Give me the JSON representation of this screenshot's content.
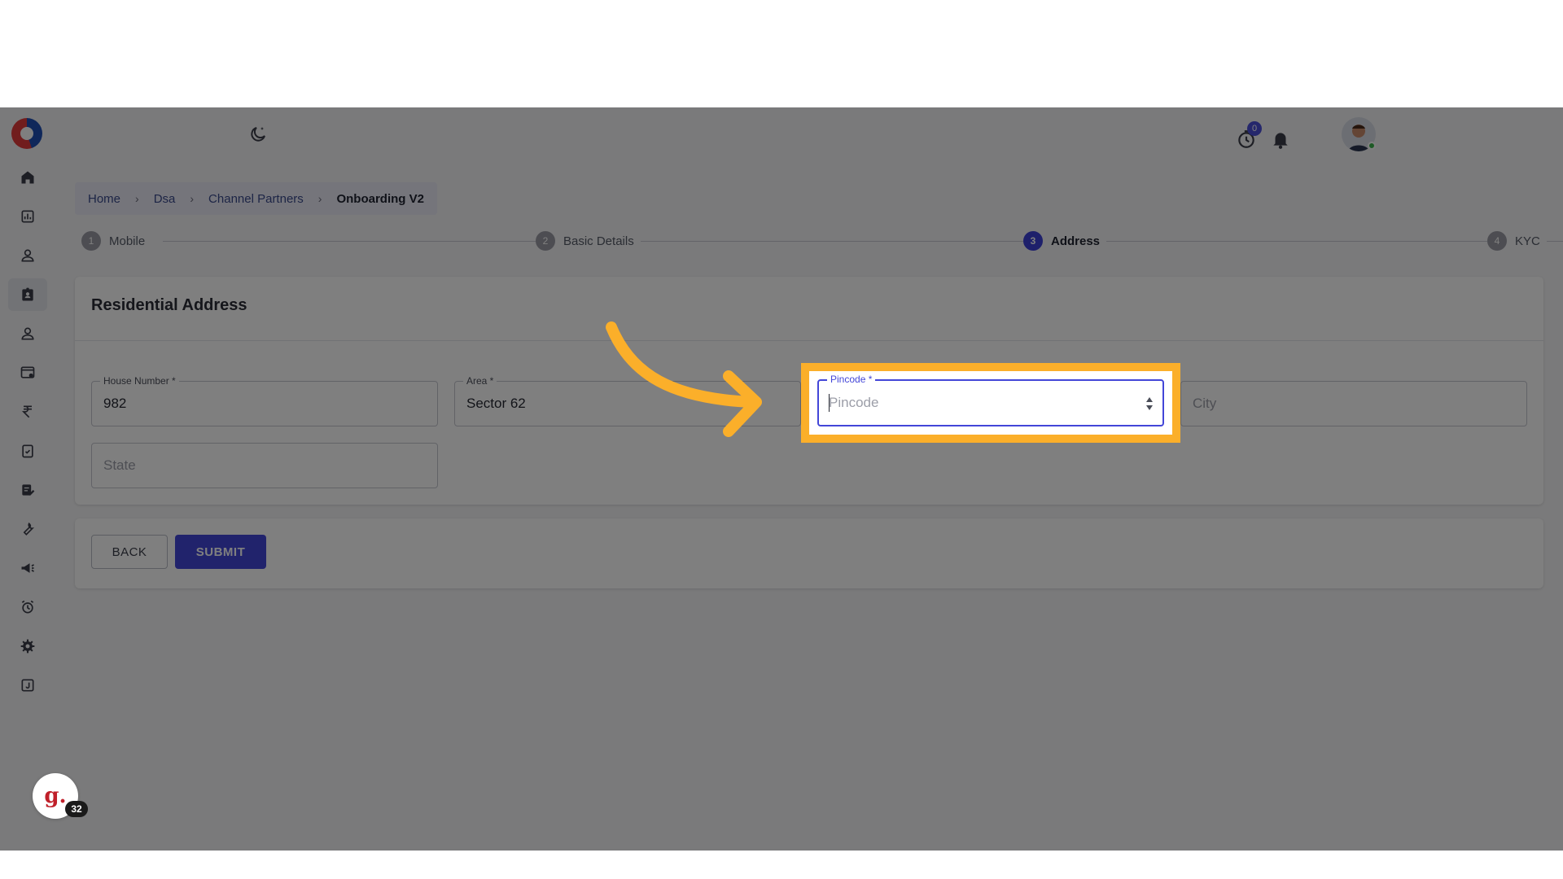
{
  "breadcrumb": {
    "items": [
      "Home",
      "Dsa",
      "Channel Partners",
      "Onboarding V2"
    ]
  },
  "stepper": {
    "steps": [
      {
        "num": "1",
        "label": "Mobile"
      },
      {
        "num": "2",
        "label": "Basic Details"
      },
      {
        "num": "3",
        "label": "Address"
      },
      {
        "num": "4",
        "label": "KYC"
      }
    ],
    "active": 3
  },
  "header": {
    "timer_badge": "0"
  },
  "form": {
    "title": "Residential Address",
    "house_number": {
      "label": "House Number *",
      "value": "982"
    },
    "area": {
      "label": "Area *",
      "value": "Sector 62"
    },
    "pincode": {
      "label": "Pincode *",
      "placeholder": "Pincode"
    },
    "city": {
      "placeholder": "City"
    },
    "state": {
      "placeholder": "State"
    }
  },
  "actions": {
    "back_label": "BACK",
    "submit_label": "SUBMIT"
  },
  "widget": {
    "glyph": "g.",
    "count": "32"
  },
  "colors": {
    "accent": "#4346d8",
    "highlight": "#fbaf2a"
  }
}
